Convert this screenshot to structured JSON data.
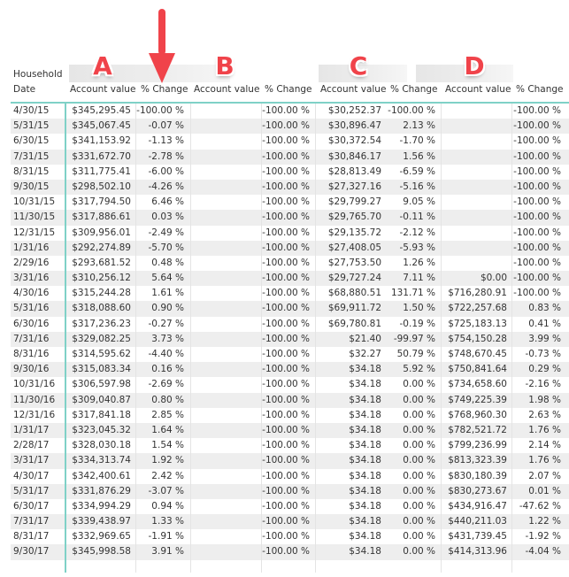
{
  "corner": {
    "row_header_label": "Household",
    "date_label": "Date"
  },
  "annotations": {
    "group_letters": [
      "A",
      "B",
      "C",
      "D"
    ],
    "arrow": "down-arrow-pointing-at-first-percent-change",
    "accent_color": "#f0434a"
  },
  "colors": {
    "header_rule": "#7fd1c7",
    "row_alt": "#eeeeee",
    "text": "#333333"
  },
  "columns": [
    {
      "group": "A",
      "account_label": "Account value",
      "change_label": "% Change"
    },
    {
      "group": "B",
      "account_label": "Account value",
      "change_label": "% Change"
    },
    {
      "group": "C",
      "account_label": "Account value",
      "change_label": "% Change"
    },
    {
      "group": "D",
      "account_label": "Account value",
      "change_label": "% Change"
    }
  ],
  "rows": [
    {
      "date": "4/30/15",
      "A": [
        "$345,295.45",
        "-100.00 %"
      ],
      "B": [
        "",
        "-100.00 %"
      ],
      "C": [
        "$30,252.37",
        "-100.00 %"
      ],
      "D": [
        "",
        "-100.00 %"
      ]
    },
    {
      "date": "5/31/15",
      "A": [
        "$345,067.45",
        "-0.07 %"
      ],
      "B": [
        "",
        "-100.00 %"
      ],
      "C": [
        "$30,896.47",
        "2.13 %"
      ],
      "D": [
        "",
        "-100.00 %"
      ]
    },
    {
      "date": "6/30/15",
      "A": [
        "$341,153.92",
        "-1.13 %"
      ],
      "B": [
        "",
        "-100.00 %"
      ],
      "C": [
        "$30,372.54",
        "-1.70 %"
      ],
      "D": [
        "",
        "-100.00 %"
      ]
    },
    {
      "date": "7/31/15",
      "A": [
        "$331,672.70",
        "-2.78 %"
      ],
      "B": [
        "",
        "-100.00 %"
      ],
      "C": [
        "$30,846.17",
        "1.56 %"
      ],
      "D": [
        "",
        "-100.00 %"
      ]
    },
    {
      "date": "8/31/15",
      "A": [
        "$311,775.41",
        "-6.00 %"
      ],
      "B": [
        "",
        "-100.00 %"
      ],
      "C": [
        "$28,813.49",
        "-6.59 %"
      ],
      "D": [
        "",
        "-100.00 %"
      ]
    },
    {
      "date": "9/30/15",
      "A": [
        "$298,502.10",
        "-4.26 %"
      ],
      "B": [
        "",
        "-100.00 %"
      ],
      "C": [
        "$27,327.16",
        "-5.16 %"
      ],
      "D": [
        "",
        "-100.00 %"
      ]
    },
    {
      "date": "10/31/15",
      "A": [
        "$317,794.50",
        "6.46 %"
      ],
      "B": [
        "",
        "-100.00 %"
      ],
      "C": [
        "$29,799.27",
        "9.05 %"
      ],
      "D": [
        "",
        "-100.00 %"
      ]
    },
    {
      "date": "11/30/15",
      "A": [
        "$317,886.61",
        "0.03 %"
      ],
      "B": [
        "",
        "-100.00 %"
      ],
      "C": [
        "$29,765.70",
        "-0.11 %"
      ],
      "D": [
        "",
        "-100.00 %"
      ]
    },
    {
      "date": "12/31/15",
      "A": [
        "$309,956.01",
        "-2.49 %"
      ],
      "B": [
        "",
        "-100.00 %"
      ],
      "C": [
        "$29,135.72",
        "-2.12 %"
      ],
      "D": [
        "",
        "-100.00 %"
      ]
    },
    {
      "date": "1/31/16",
      "A": [
        "$292,274.89",
        "-5.70 %"
      ],
      "B": [
        "",
        "-100.00 %"
      ],
      "C": [
        "$27,408.05",
        "-5.93 %"
      ],
      "D": [
        "",
        "-100.00 %"
      ]
    },
    {
      "date": "2/29/16",
      "A": [
        "$293,681.52",
        "0.48 %"
      ],
      "B": [
        "",
        "-100.00 %"
      ],
      "C": [
        "$27,753.50",
        "1.26 %"
      ],
      "D": [
        "",
        "-100.00 %"
      ]
    },
    {
      "date": "3/31/16",
      "A": [
        "$310,256.12",
        "5.64 %"
      ],
      "B": [
        "",
        "-100.00 %"
      ],
      "C": [
        "$29,727.24",
        "7.11 %"
      ],
      "D": [
        "$0.00",
        "-100.00 %"
      ]
    },
    {
      "date": "4/30/16",
      "A": [
        "$315,244.28",
        "1.61 %"
      ],
      "B": [
        "",
        "-100.00 %"
      ],
      "C": [
        "$68,880.51",
        "131.71 %"
      ],
      "D": [
        "$716,280.91",
        "-100.00 %"
      ]
    },
    {
      "date": "5/31/16",
      "A": [
        "$318,088.60",
        "0.90 %"
      ],
      "B": [
        "",
        "-100.00 %"
      ],
      "C": [
        "$69,911.72",
        "1.50 %"
      ],
      "D": [
        "$722,257.68",
        "0.83 %"
      ]
    },
    {
      "date": "6/30/16",
      "A": [
        "$317,236.23",
        "-0.27 %"
      ],
      "B": [
        "",
        "-100.00 %"
      ],
      "C": [
        "$69,780.81",
        "-0.19 %"
      ],
      "D": [
        "$725,183.13",
        "0.41 %"
      ]
    },
    {
      "date": "7/31/16",
      "A": [
        "$329,082.25",
        "3.73 %"
      ],
      "B": [
        "",
        "-100.00 %"
      ],
      "C": [
        "$21.40",
        "-99.97 %"
      ],
      "D": [
        "$754,150.28",
        "3.99 %"
      ]
    },
    {
      "date": "8/31/16",
      "A": [
        "$314,595.62",
        "-4.40 %"
      ],
      "B": [
        "",
        "-100.00 %"
      ],
      "C": [
        "$32.27",
        "50.79 %"
      ],
      "D": [
        "$748,670.45",
        "-0.73 %"
      ]
    },
    {
      "date": "9/30/16",
      "A": [
        "$315,083.34",
        "0.16 %"
      ],
      "B": [
        "",
        "-100.00 %"
      ],
      "C": [
        "$34.18",
        "5.92 %"
      ],
      "D": [
        "$750,841.64",
        "0.29 %"
      ]
    },
    {
      "date": "10/31/16",
      "A": [
        "$306,597.98",
        "-2.69 %"
      ],
      "B": [
        "",
        "-100.00 %"
      ],
      "C": [
        "$34.18",
        "0.00 %"
      ],
      "D": [
        "$734,658.60",
        "-2.16 %"
      ]
    },
    {
      "date": "11/30/16",
      "A": [
        "$309,040.87",
        "0.80 %"
      ],
      "B": [
        "",
        "-100.00 %"
      ],
      "C": [
        "$34.18",
        "0.00 %"
      ],
      "D": [
        "$749,225.39",
        "1.98 %"
      ]
    },
    {
      "date": "12/31/16",
      "A": [
        "$317,841.18",
        "2.85 %"
      ],
      "B": [
        "",
        "-100.00 %"
      ],
      "C": [
        "$34.18",
        "0.00 %"
      ],
      "D": [
        "$768,960.30",
        "2.63 %"
      ]
    },
    {
      "date": "1/31/17",
      "A": [
        "$323,045.32",
        "1.64 %"
      ],
      "B": [
        "",
        "-100.00 %"
      ],
      "C": [
        "$34.18",
        "0.00 %"
      ],
      "D": [
        "$782,521.72",
        "1.76 %"
      ]
    },
    {
      "date": "2/28/17",
      "A": [
        "$328,030.18",
        "1.54 %"
      ],
      "B": [
        "",
        "-100.00 %"
      ],
      "C": [
        "$34.18",
        "0.00 %"
      ],
      "D": [
        "$799,236.99",
        "2.14 %"
      ]
    },
    {
      "date": "3/31/17",
      "A": [
        "$334,313.74",
        "1.92 %"
      ],
      "B": [
        "",
        "-100.00 %"
      ],
      "C": [
        "$34.18",
        "0.00 %"
      ],
      "D": [
        "$813,323.39",
        "1.76 %"
      ]
    },
    {
      "date": "4/30/17",
      "A": [
        "$342,400.61",
        "2.42 %"
      ],
      "B": [
        "",
        "-100.00 %"
      ],
      "C": [
        "$34.18",
        "0.00 %"
      ],
      "D": [
        "$830,180.39",
        "2.07 %"
      ]
    },
    {
      "date": "5/31/17",
      "A": [
        "$331,876.29",
        "-3.07 %"
      ],
      "B": [
        "",
        "-100.00 %"
      ],
      "C": [
        "$34.18",
        "0.00 %"
      ],
      "D": [
        "$830,273.67",
        "0.01 %"
      ]
    },
    {
      "date": "6/30/17",
      "A": [
        "$334,994.29",
        "0.94 %"
      ],
      "B": [
        "",
        "-100.00 %"
      ],
      "C": [
        "$34.18",
        "0.00 %"
      ],
      "D": [
        "$434,916.47",
        "-47.62 %"
      ]
    },
    {
      "date": "7/31/17",
      "A": [
        "$339,438.97",
        "1.33 %"
      ],
      "B": [
        "",
        "-100.00 %"
      ],
      "C": [
        "$34.18",
        "0.00 %"
      ],
      "D": [
        "$440,211.03",
        "1.22 %"
      ]
    },
    {
      "date": "8/31/17",
      "A": [
        "$332,969.65",
        "-1.91 %"
      ],
      "B": [
        "",
        "-100.00 %"
      ],
      "C": [
        "$34.18",
        "0.00 %"
      ],
      "D": [
        "$431,739.45",
        "-1.92 %"
      ]
    },
    {
      "date": "9/30/17",
      "A": [
        "$345,998.58",
        "3.91 %"
      ],
      "B": [
        "",
        "-100.00 %"
      ],
      "C": [
        "$34.18",
        "0.00 %"
      ],
      "D": [
        "$414,313.96",
        "-4.04 %"
      ]
    }
  ]
}
